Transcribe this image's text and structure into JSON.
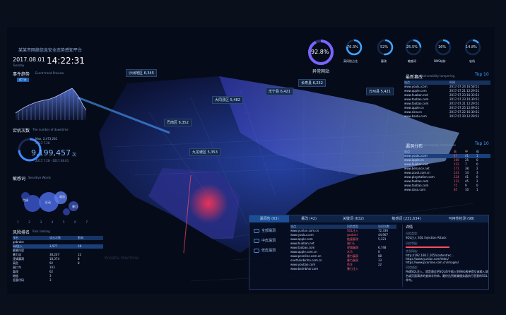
{
  "header": {
    "title": "某某市网络信息安全态势感知平台",
    "date": "2017.08.01",
    "weekday": "Tuesday",
    "time": "14:22:31"
  },
  "left": {
    "trend_title": "事件趋势",
    "trend_sub": "Event trend Preview",
    "trend_tag": "近7天",
    "outage_title": "宕机次数",
    "outage_sub": "The number of downtime",
    "outage_max_label": "Max.",
    "outage_max_value": "2,473,281",
    "outage_max_date": "2017.7.28",
    "outage_max_date2": "2017.7.28 - 2017.08.01",
    "outage_value": "9,199,457",
    "outage_unit": "次",
    "sensitive_title": "敏感词",
    "sensitive_sub": "Sensitive Words",
    "sensitive_words": [
      "色情",
      "反动",
      "政治",
      "暴力",
      "赌博",
      "诈骗"
    ],
    "sensitive_days": [
      "1",
      "2",
      "3",
      "4",
      "5",
      "6",
      "7"
    ],
    "rank_title": "风险排名",
    "rank_sub": "Risk ranking",
    "rank_cols": [
      "排名",
      "站点",
      "攻击次数",
      "影响"
    ],
    "rank_rows": [
      {
        "name": "gsbrake",
        "a": "",
        "b": ""
      },
      {
        "name": "sql注入",
        "a": "3,577",
        "b": "18"
      },
      {
        "name": "敏感内容",
        "a": "",
        "b": ""
      },
      {
        "name": "暴力攻",
        "a": "38,247",
        "b": "12"
      },
      {
        "name": "逻辑漏洞",
        "a": "18,374",
        "b": "8"
      },
      {
        "name": "高危",
        "a": "92",
        "b": "8"
      },
      {
        "name": "弱口令",
        "a": "103",
        "b": ""
      },
      {
        "name": "篡改",
        "a": "62",
        "b": ""
      },
      {
        "name": "暗链",
        "a": "3",
        "b": ""
      },
      {
        "name": "恶意代码",
        "a": "3",
        "b": ""
      }
    ]
  },
  "kpis": {
    "main_value": "92.8%",
    "main_label": "异常网站",
    "items": [
      {
        "value": "76.3%",
        "label": "高风险占比"
      },
      {
        "value": "52%",
        "label": "篡改"
      },
      {
        "value": "25.5%",
        "label": "敏感词"
      },
      {
        "value": "16%",
        "label": "DNS劫持"
      },
      {
        "value": "14.8%",
        "label": "宕机"
      }
    ]
  },
  "map": {
    "labels": [
      {
        "name": "沙洲地区",
        "value": "6,345"
      },
      {
        "name": "大同县区",
        "value": "5,482"
      },
      {
        "name": "巴南区",
        "value": "6,352"
      },
      {
        "name": "长寿县",
        "value": "6,252"
      },
      {
        "name": "乐宁县",
        "value": "6,421"
      },
      {
        "name": "九龙坡区",
        "value": "5,353"
      },
      {
        "name": "万州县",
        "value": "5,421"
      }
    ],
    "watermark": "Kreativ Machine"
  },
  "right": {
    "latest_title": "最新篡改",
    "latest_sub": "Vulnerability tampering",
    "latest_top": "Top 10",
    "latest_cols": [
      "站点",
      "时间"
    ],
    "latest_rows": [
      {
        "site": "www.youku.com",
        "time": "2017.07.24 16:58:51"
      },
      {
        "site": "www.apple.com",
        "time": "2017.07.21 12:29:51"
      },
      {
        "site": "www.huaban.net",
        "time": "2017.07.23 16:33:51"
      },
      {
        "site": "www.taobao.com",
        "time": "2017.07.23 10:30:51"
      },
      {
        "site": "www.taobao.com",
        "time": "2017.07.21 12:29:51"
      },
      {
        "site": "www.apple.cn",
        "time": "2017.07.25 12:09:51"
      },
      {
        "site": "www.sina.cn",
        "time": "2017.07.22 16:30:51"
      },
      {
        "site": "www.baidu.com",
        "time": "2017.07.20 12:29:51"
      }
    ],
    "vuln_title": "漏洞分布",
    "vuln_sub": "Vulnerability distribution",
    "vuln_top": "Top 10",
    "vuln_cols": [
      "站点",
      "高",
      "中",
      "低"
    ],
    "vuln_rows": [
      {
        "site": "www.youku.com",
        "h": "47",
        "m": "41",
        "l": "1"
      },
      {
        "site": "www.apple.cn",
        "h": "166",
        "m": "25",
        "l": "0"
      },
      {
        "site": "www.huaban.net",
        "h": "152",
        "m": "7",
        "l": "0"
      },
      {
        "site": "www.behance.net",
        "h": "171",
        "m": "38",
        "l": "2"
      },
      {
        "site": "www.zcool.com.cn",
        "h": "141",
        "m": "14",
        "l": "3"
      },
      {
        "site": "www.playstation.com",
        "h": "124",
        "m": "41",
        "l": "0"
      },
      {
        "site": "www.taobao.com",
        "h": "112",
        "m": "45",
        "l": "2"
      },
      {
        "site": "www.taobao.com",
        "h": "75",
        "m": "9",
        "l": "0"
      },
      {
        "site": "www.daso.com",
        "h": "65",
        "m": "10",
        "l": "1"
      }
    ]
  },
  "bottom": {
    "tabs": [
      "漏洞告 (63)",
      "篡改 (42)",
      "关键词 (632)",
      "敏感词 (231,634)",
      "可用性检测 (98)"
    ],
    "sidebar": [
      "全部漏洞",
      "中危漏洞",
      "低危漏洞"
    ],
    "cols": [
      "站点",
      "风险类型",
      "访问次数"
    ],
    "rows": [
      {
        "site": "www.yunlun.com.cn",
        "type": "SQL注入",
        "count": "72,336"
      },
      {
        "site": "www.youku.com",
        "type": "gesbrel",
        "count": "44,907"
      },
      {
        "site": "www.apple.com",
        "type": "链接篡改",
        "count": "5,321"
      },
      {
        "site": "www.huaban.net",
        "type": "暗C马",
        "count": ""
      },
      {
        "site": "www.taobao.com",
        "type": "逻辑漏洞",
        "count": "6,748"
      },
      {
        "site": "www.apple.com.cn",
        "type": "木马",
        "count": "0"
      },
      {
        "site": "www.pconline.com.cn",
        "type": "暴力漏洞",
        "count": "88"
      },
      {
        "site": "onethainbinhn.com.cn",
        "type": "暴力漏洞",
        "count": "33"
      },
      {
        "site": "www.youbao.com",
        "type": "旁注",
        "count": "22"
      },
      {
        "site": "www.baimbhor.com",
        "type": "暴力注入",
        "count": ""
      }
    ],
    "detail_title": "详情",
    "detail_rows": [
      {
        "k": "风险类型:",
        "v": "SQL注入   SQL Injection Attack"
      },
      {
        "k": "风险等级:",
        "v": ""
      },
      {
        "k": "涉及网站:",
        "v": "http://192.168.1.105/contentrec...\nhttps://www.yunlun.com/ddos/\nhttps://www.pconline.com.cn/images/"
      },
      {
        "k": "风险描述:",
        "v": "所谓SQL注入，就是通过把SQL命令插入到Web表单提交或输入域名或页面请求的查询字符串，最终达到欺骗服务器执行恶意的SQL命令。"
      }
    ]
  },
  "colors": {
    "accent": "#2aa8ff",
    "danger": "#ff4d5e",
    "bg": "#060b1a"
  }
}
